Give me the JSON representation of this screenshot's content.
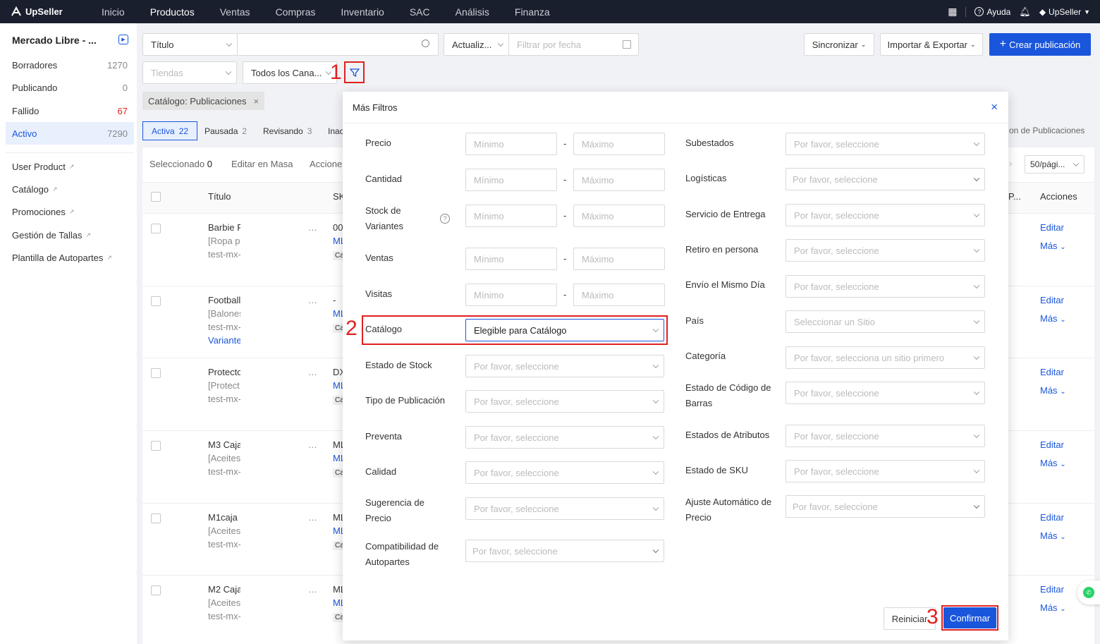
{
  "app": {
    "logo": "UpSeller"
  },
  "nav": {
    "items": [
      "Inicio",
      "Productos",
      "Ventas",
      "Compras",
      "Inventario",
      "SAC",
      "Análisis",
      "Finanza"
    ],
    "active": "Productos",
    "help": "Ayuda",
    "user": "UpSeller"
  },
  "sidebar": {
    "title": "Mercado Libre - ...",
    "statuses": [
      {
        "label": "Borradores",
        "count": "1270"
      },
      {
        "label": "Publicando",
        "count": "0"
      },
      {
        "label": "Fallido",
        "count": "67"
      },
      {
        "label": "Activo",
        "count": "7290"
      }
    ],
    "links": [
      "User Product",
      "Catálogo",
      "Promociones",
      "Gestión de Tallas",
      "Plantilla de Autopartes"
    ]
  },
  "toolbar": {
    "search_type": "Título",
    "update_select": "Actualiz...",
    "date_placeholder": "Filtrar por fecha",
    "sync": "Sincronizar",
    "import_export": "Importar & Exportar",
    "create": "Crear publicación",
    "stores_placeholder": "Tiendas",
    "channels": "Todos los Cana...",
    "filter_tag": "Catálogo: Publicaciones"
  },
  "tabs": [
    {
      "label": "Activa",
      "count": "22"
    },
    {
      "label": "Pausada",
      "count": "2"
    },
    {
      "label": "Revisando",
      "count": "3"
    },
    {
      "label": "Inac",
      "count": ""
    }
  ],
  "right_tab_text": "on de Publicaciones",
  "table": {
    "selected_label": "Seleccionado",
    "selected_count": "0",
    "bulk_edit": "Editar en Masa",
    "actions": "Acciones",
    "page_size": "50/pági...",
    "col_title": "Título",
    "col_sku": "SK",
    "col_p": "P...",
    "col_actions": "Acciones",
    "rows": [
      {
        "title": "Barbie F",
        "sub": "[Ropa p",
        "id": "test-mx-",
        "sku": "00",
        "ml": "ML",
        "chip": "Ca",
        "extra": "",
        "edit": "Editar",
        "more": "Más"
      },
      {
        "title": "Football",
        "sub": "[Balones",
        "id": "test-mx-",
        "sku": "-",
        "ml": "ML",
        "chip": "Ca",
        "extra": "Variante",
        "edit": "Editar",
        "more": "Más"
      },
      {
        "title": "Protecto",
        "sub": "[Protect",
        "id": "test-mx-",
        "sku": "DX",
        "ml": "ML",
        "chip": "Ca",
        "extra": "",
        "edit": "Editar",
        "more": "Más"
      },
      {
        "title": "M3 Caja",
        "sub": "[Aceites",
        "id": "test-mx-",
        "sku": "ML",
        "ml": "ML",
        "chip": "Ca",
        "extra": "",
        "edit": "Editar",
        "more": "Más"
      },
      {
        "title": "M1caja",
        "sub": "[Aceites",
        "id": "test-mx-",
        "sku": "ML",
        "ml": "ML",
        "chip": "Ca",
        "extra": "",
        "edit": "Editar",
        "more": "Más"
      },
      {
        "title": "M2 Caja",
        "sub": "[Aceites",
        "id": "test-mx-",
        "sku": "ML",
        "ml": "ML",
        "chip": "Ca",
        "extra": "",
        "edit": "Editar",
        "more": "Más"
      }
    ]
  },
  "modal": {
    "title": "Más Filtros",
    "min": "Mínimo",
    "max": "Máximo",
    "dash": "-",
    "left": {
      "precio": "Precio",
      "cantidad": "Cantidad",
      "stock_variantes": "Stock de Variantes",
      "ventas": "Ventas",
      "visitas": "Visitas",
      "catalogo": "Catálogo",
      "catalogo_value": "Elegible para Catálogo",
      "estado_stock": "Estado de Stock",
      "tipo_pub": "Tipo de Publicación",
      "preventa": "Preventa",
      "calidad": "Calidad",
      "sugerencia": "Sugerencia de Precio",
      "compat": "Compatibilidad de Autopartes"
    },
    "right": {
      "subestados": "Subestados",
      "logisticas": "Logísticas",
      "servicio": "Servicio de Entrega",
      "retiro": "Retiro en persona",
      "envio": "Envío el Mismo Día",
      "pais": "País",
      "categoria": "Categoría",
      "codigo_barras": "Estado de Código de Barras",
      "atributos": "Estados de Atributos",
      "sku": "Estado de SKU",
      "ajuste": "Ajuste Automático de Precio"
    },
    "select_ph": "Por favor, seleccione",
    "site_ph": "Seleccionar un Sitio",
    "cat_ph": "Por favor, selecciona un sitio primero",
    "reset": "Reiniciar",
    "confirm": "Confirmar"
  },
  "annotations": [
    "1",
    "2",
    "3"
  ],
  "colors": {
    "primary": "#1a56db",
    "nav_bg": "#1a1f2e",
    "annotation": "#e02020"
  }
}
